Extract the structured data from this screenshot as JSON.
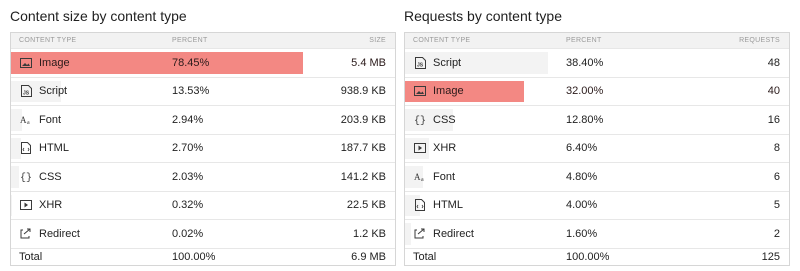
{
  "left": {
    "title": "Content size by content type",
    "headers": {
      "type": "CONTENT TYPE",
      "percent": "PERCENT",
      "value": "SIZE"
    },
    "rows": [
      {
        "icon": "image-icon",
        "type": "Image",
        "percent": "78.45%",
        "value": "5.4 MB",
        "share": 0.7845,
        "highlighted": true
      },
      {
        "icon": "script-icon",
        "type": "Script",
        "percent": "13.53%",
        "value": "938.9 KB",
        "share": 0.1353,
        "highlighted": false
      },
      {
        "icon": "font-icon",
        "type": "Font",
        "percent": "2.94%",
        "value": "203.9 KB",
        "share": 0.0294,
        "highlighted": false
      },
      {
        "icon": "html-icon",
        "type": "HTML",
        "percent": "2.70%",
        "value": "187.7 KB",
        "share": 0.027,
        "highlighted": false
      },
      {
        "icon": "css-icon",
        "type": "CSS",
        "percent": "2.03%",
        "value": "141.2 KB",
        "share": 0.0203,
        "highlighted": false
      },
      {
        "icon": "xhr-icon",
        "type": "XHR",
        "percent": "0.32%",
        "value": "22.5 KB",
        "share": 0.0032,
        "highlighted": false
      },
      {
        "icon": "redirect-icon",
        "type": "Redirect",
        "percent": "0.02%",
        "value": "1.2 KB",
        "share": 0.0002,
        "highlighted": false
      }
    ],
    "total": {
      "label": "Total",
      "percent": "100.00%",
      "value": "6.9 MB"
    }
  },
  "right": {
    "title": "Requests by content type",
    "headers": {
      "type": "CONTENT TYPE",
      "percent": "PERCENT",
      "value": "REQUESTS"
    },
    "rows": [
      {
        "icon": "script-icon",
        "type": "Script",
        "percent": "38.40%",
        "value": "48",
        "share": 0.384,
        "highlighted": false
      },
      {
        "icon": "image-icon",
        "type": "Image",
        "percent": "32.00%",
        "value": "40",
        "share": 0.32,
        "highlighted": true
      },
      {
        "icon": "css-icon",
        "type": "CSS",
        "percent": "12.80%",
        "value": "16",
        "share": 0.128,
        "highlighted": false
      },
      {
        "icon": "xhr-icon",
        "type": "XHR",
        "percent": "6.40%",
        "value": "8",
        "share": 0.064,
        "highlighted": false
      },
      {
        "icon": "font-icon",
        "type": "Font",
        "percent": "4.80%",
        "value": "6",
        "share": 0.048,
        "highlighted": false
      },
      {
        "icon": "html-icon",
        "type": "HTML",
        "percent": "4.00%",
        "value": "5",
        "share": 0.04,
        "highlighted": false
      },
      {
        "icon": "redirect-icon",
        "type": "Redirect",
        "percent": "1.60%",
        "value": "2",
        "share": 0.016,
        "highlighted": false
      }
    ],
    "total": {
      "label": "Total",
      "percent": "100.00%",
      "value": "125"
    }
  },
  "colors": {
    "highlight": "#f38883",
    "bar": "#f3f3f3",
    "header_bg": "#f2f2f2"
  }
}
